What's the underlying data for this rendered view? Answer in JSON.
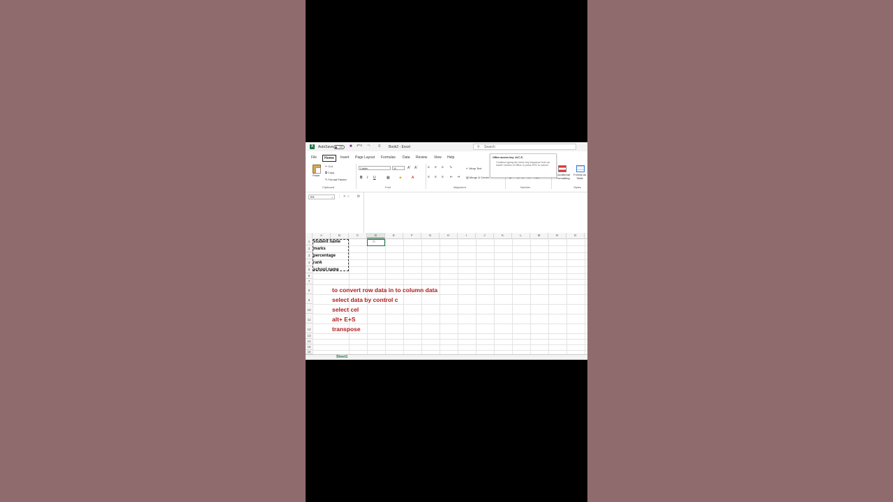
{
  "app": {
    "autosave_label": "AutoSave",
    "autosave_state": "Off",
    "doc_title": "Book2 - Excel",
    "search_placeholder": "Search"
  },
  "tabs": [
    {
      "label": "File"
    },
    {
      "label": "Home",
      "active": true
    },
    {
      "label": "Insert"
    },
    {
      "label": "Page Layout"
    },
    {
      "label": "Formulas"
    },
    {
      "label": "Data"
    },
    {
      "label": "Review"
    },
    {
      "label": "View"
    },
    {
      "label": "Help"
    }
  ],
  "ribbon": {
    "clipboard": {
      "label": "Clipboard",
      "paste": "Paste",
      "cut": "Cut",
      "copy": "Copy",
      "format_painter": "Format Painter"
    },
    "font": {
      "label": "Font",
      "font_name": "Calibri",
      "font_size": "11",
      "bold": "B",
      "italic": "I",
      "underline": "U"
    },
    "alignment": {
      "label": "Alignment",
      "wrap_text": "Wrap Text",
      "merge_center": "Merge & Center"
    },
    "number": {
      "label": "Number"
    },
    "styles": {
      "label": "Styles",
      "conditional_formatting": "Conditional Formatting",
      "format_as_table": "Format as Table"
    }
  },
  "tooltip": {
    "title": "Office access key: ALT, E,",
    "body": "Continue typing the menu key sequence from an earlier version of Office or press ESC to cancel."
  },
  "formula_bar": {
    "name_box": "D1",
    "fx": "fx"
  },
  "grid": {
    "columns": [
      "A",
      "B",
      "C",
      "D",
      "E",
      "F",
      "G",
      "H",
      "I",
      "J",
      "K",
      "L",
      "M",
      "N",
      "O"
    ],
    "selected_column": "D",
    "rows": [
      "1",
      "2",
      "3",
      "4",
      "5",
      "6",
      "7",
      "8",
      "9",
      "10",
      "11",
      "12",
      "13",
      "14",
      "15",
      "16"
    ],
    "cells_col_a": [
      "student name",
      "marks",
      "percentage",
      "rank",
      "school name"
    ],
    "notes": [
      "to convert row data in to column data",
      "select data by control c",
      "select cel",
      "alt+ E+S",
      "transpose"
    ],
    "sheet_tab": "Sheet1"
  },
  "colors": {
    "excel_green": "#1d6f42",
    "note_red": "#b01b1b",
    "background": "#8f6b6d"
  }
}
